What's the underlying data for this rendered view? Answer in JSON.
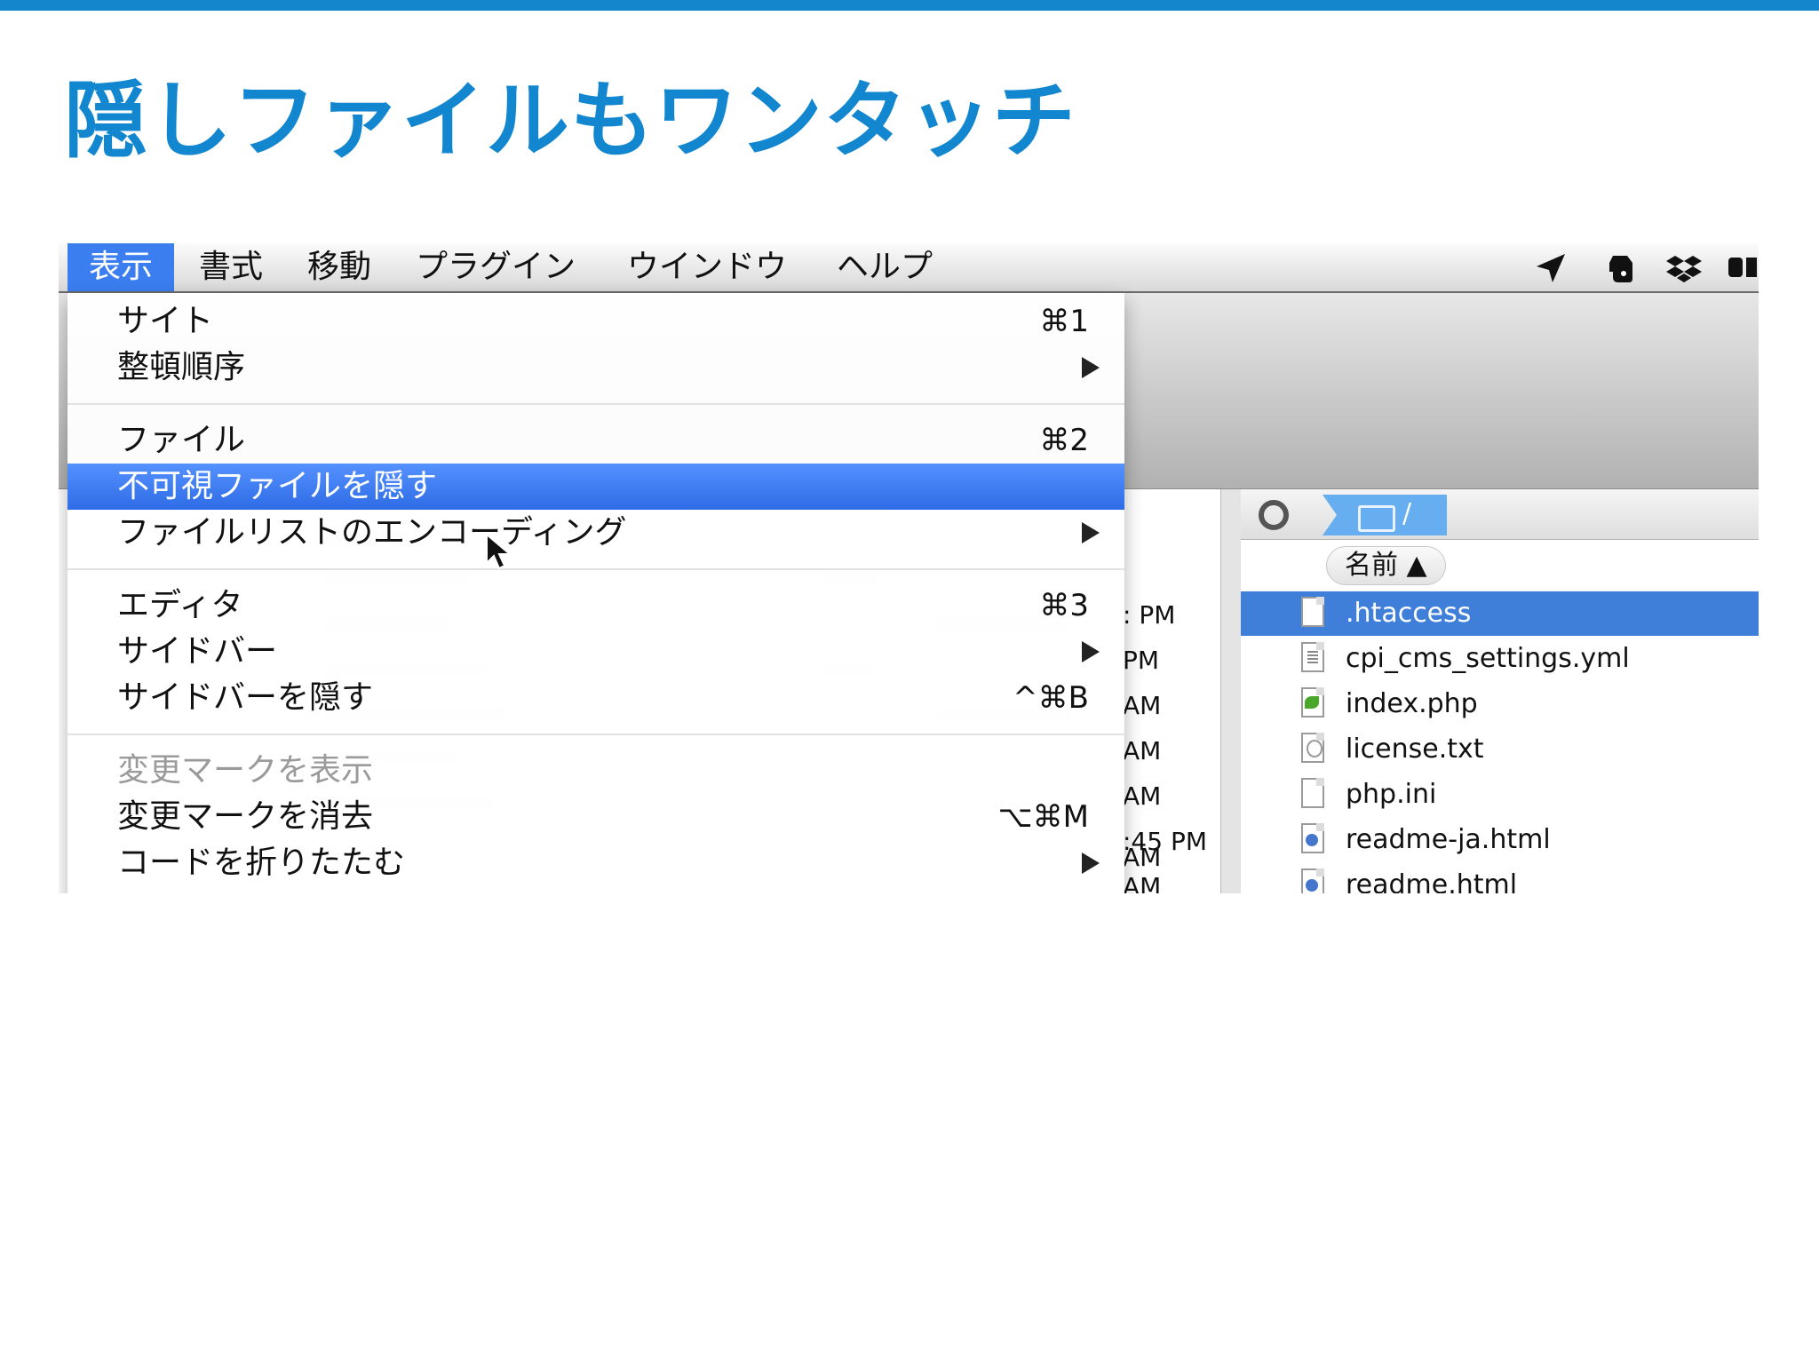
{
  "slide": {
    "title": "隠しファイルもワンタッチ"
  },
  "menubar": {
    "items": [
      {
        "label": "表示",
        "active": true
      },
      {
        "label": "書式"
      },
      {
        "label": "移動"
      },
      {
        "label": "プラグイン"
      },
      {
        "label": "ウインドウ"
      },
      {
        "label": "ヘルプ"
      }
    ],
    "status_icons": [
      "location-arrow-icon",
      "evernote-icon",
      "dropbox-icon",
      "extra-icon"
    ]
  },
  "view_menu": {
    "items": [
      {
        "label": "サイト",
        "shortcut": "⌘1"
      },
      {
        "label": "整頓順序",
        "submenu": true
      },
      {
        "label": "ファイル",
        "shortcut": "⌘2"
      },
      {
        "label": "不可視ファイルを隠す",
        "highlighted": true
      },
      {
        "label": "ファイルリストのエンコーディング",
        "submenu": true
      },
      {
        "label": "エディタ",
        "shortcut": "⌘3"
      },
      {
        "label": "サイドバー",
        "submenu": true
      },
      {
        "label": "サイドバーを隠す",
        "shortcut": "^⌘B"
      },
      {
        "label": "変更マークを表示",
        "disabled": true
      },
      {
        "label": "変更マークを消去",
        "shortcut": "⌥⌘M"
      },
      {
        "label": "コードを折りたたむ",
        "submenu": true
      }
    ]
  },
  "left_pane": {
    "timestamps": [
      ": PM",
      "PM",
      "AM",
      "AM",
      "AM",
      ":45 PM",
      "AM"
    ]
  },
  "right_pane": {
    "path": "/",
    "column_header": "名前 ▲",
    "files": [
      {
        "name": ".htaccess",
        "icon": "generic-file-icon",
        "selected": true
      },
      {
        "name": "cpi_cms_settings.yml",
        "icon": "yml-file-icon"
      },
      {
        "name": "index.php",
        "icon": "php-file-icon"
      },
      {
        "name": "license.txt",
        "icon": "txt-file-icon"
      },
      {
        "name": "php.ini",
        "icon": "generic-file-icon"
      },
      {
        "name": "readme-ja.html",
        "icon": "html-file-icon"
      },
      {
        "name": "readme.html",
        "icon": "html-file-icon"
      }
    ]
  },
  "colors": {
    "accent": "#1287cf",
    "menu_highlight": "#3b7ef0",
    "selection": "#3f7fd9"
  }
}
